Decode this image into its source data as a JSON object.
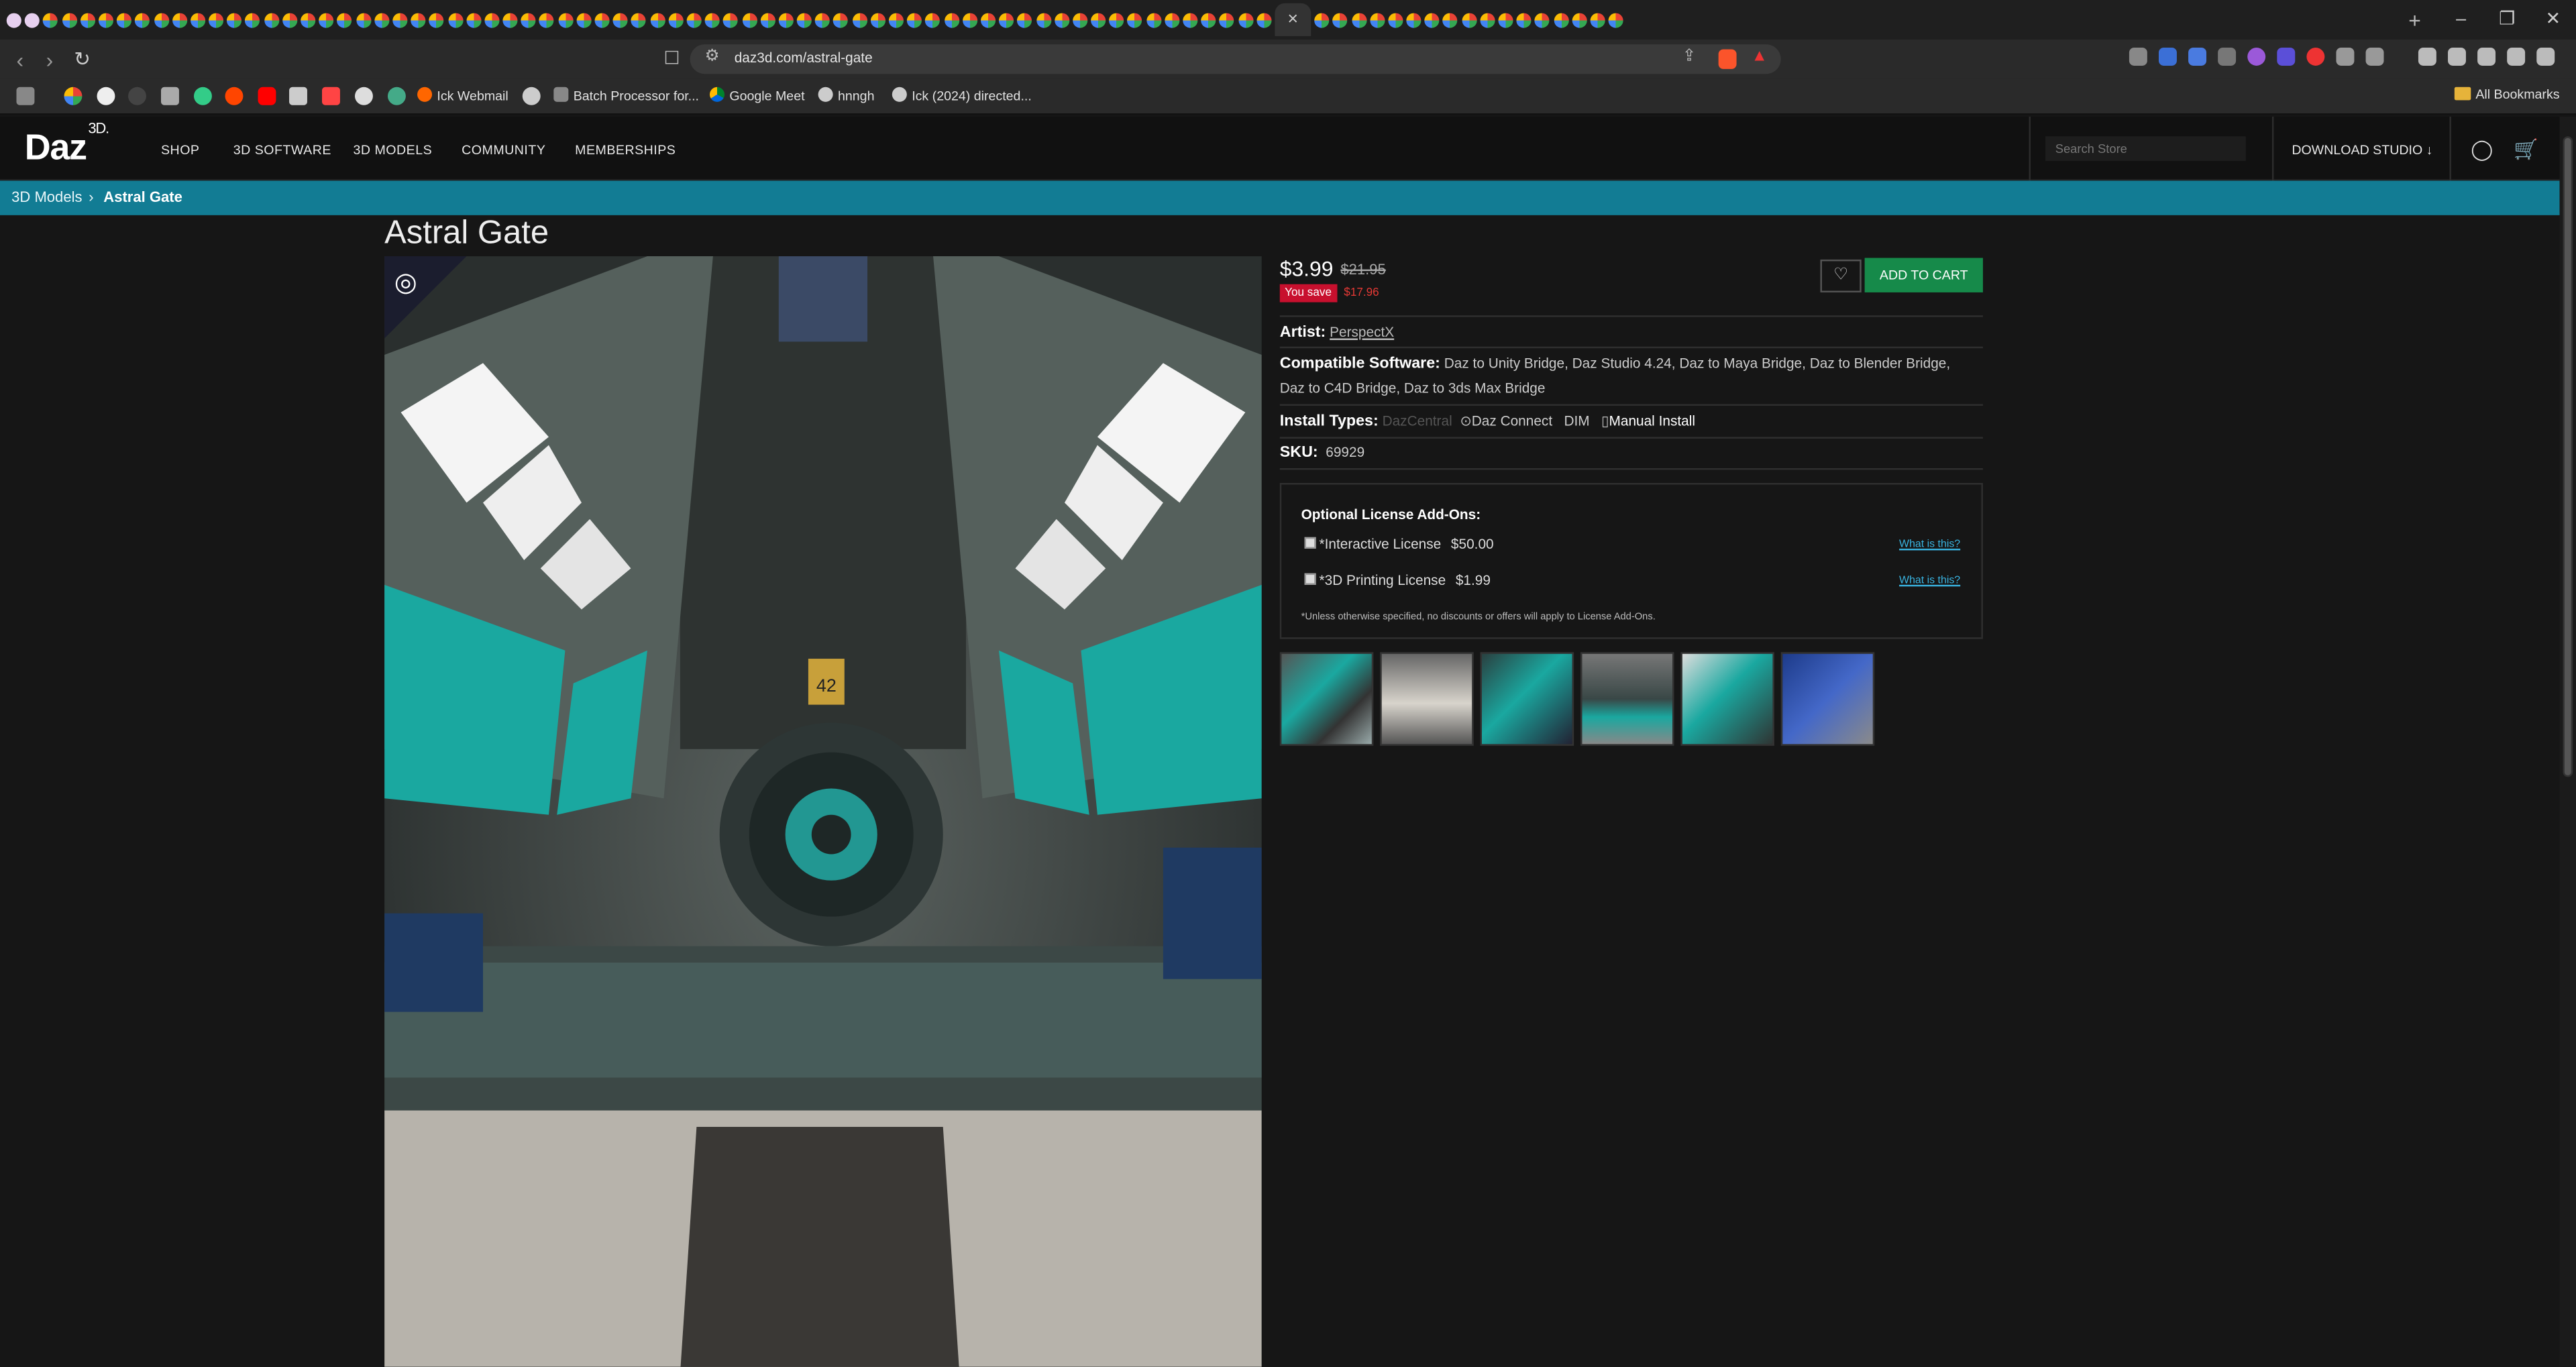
{
  "browser": {
    "url": "daz3d.com/astral-gate",
    "close_tab": "×",
    "new_tab": "+",
    "window_controls": [
      "–",
      "❐",
      "✕"
    ]
  },
  "bookmarks": [
    {
      "label": "Ick Webmail"
    },
    {
      "label": "Batch Processor for..."
    },
    {
      "label": "Google Meet"
    },
    {
      "label": "hnngh"
    },
    {
      "label": "Ick (2024) directed..."
    }
  ],
  "all_bookmarks": "All Bookmarks",
  "site": {
    "logo": "Daz",
    "logo_sup": "3D.",
    "nav": [
      "SHOP",
      "3D SOFTWARE",
      "3D MODELS",
      "COMMUNITY",
      "MEMBERSHIPS"
    ],
    "search_placeholder": "Search Store",
    "download": "DOWNLOAD STUDIO"
  },
  "breadcrumb": {
    "parent": "3D Models",
    "current": "Astral Gate"
  },
  "product": {
    "title": "Astral Gate",
    "price": "$3.99",
    "old_price": "$21.95",
    "you_save_label": "You save",
    "you_save_amount": "$17.96",
    "add_to_cart": "ADD TO CART",
    "artist_label": "Artist:",
    "artist": "PerspectX",
    "compat_label": "Compatible Software:",
    "compat": "Daz to Unity Bridge, Daz Studio 4.24, Daz to Maya Bridge, Daz to Blender Bridge, Daz to C4D Bridge, Daz to 3ds Max Bridge",
    "install_label": "Install Types:",
    "install_types": [
      "DazCentral",
      "Daz Connect",
      "DIM",
      "Manual Install"
    ],
    "sku_label": "SKU:",
    "sku": "69929"
  },
  "license": {
    "heading": "Optional License Add-Ons:",
    "items": [
      {
        "name": "*Interactive License",
        "price": "$50.00",
        "link": "What is this?"
      },
      {
        "name": "*3D Printing License",
        "price": "$1.99",
        "link": "What is this?"
      }
    ],
    "note": "*Unless otherwise specified, no discounts or offers will apply to License Add-Ons."
  },
  "hero_sign": "42",
  "colors": {
    "accent": "#127c94",
    "cart": "#168a4a",
    "save": "#c8102e"
  }
}
